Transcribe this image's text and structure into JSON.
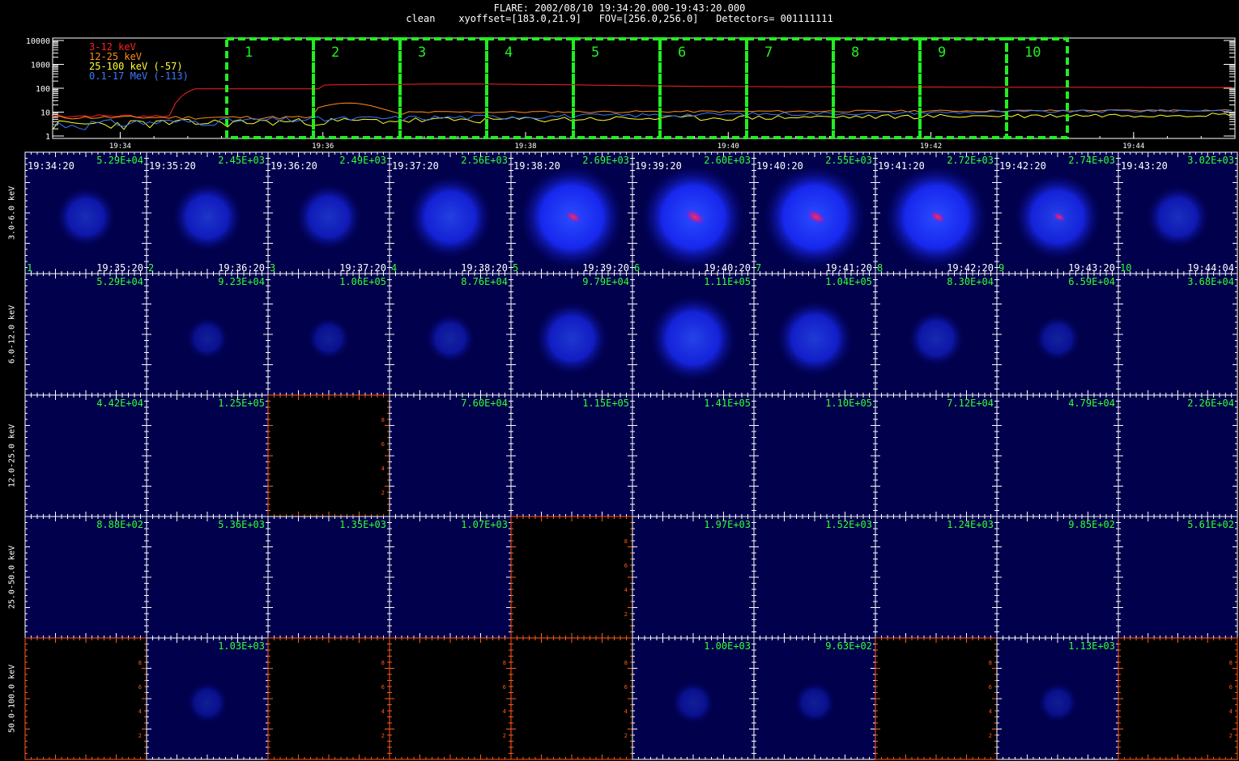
{
  "header": {
    "line1": "FLARE: 2002/08/10 19:34:20.000-19:43:20.000",
    "line2": "clean    xyoffset=[183.0,21.9]   FOV=[256.0,256.0]   Detectors= 001111111"
  },
  "lightcurve": {
    "y_ticks": [
      "10000",
      "1000",
      "100",
      "10",
      "1"
    ],
    "x_ticks": [
      "19:34",
      "19:36",
      "19:38",
      "19:40",
      "19:42",
      "19:44",
      "19:4"
    ],
    "legend": [
      {
        "label": "3-12 keV",
        "color": "#ff2020"
      },
      {
        "label": "12-25 keV",
        "color": "#ff8c1a"
      },
      {
        "label": "25-100 keV (-57)",
        "color": "#ffff33"
      },
      {
        "label": "0.1-17 MeV (-113)",
        "color": "#3a7bff"
      }
    ],
    "interval_labels": [
      "1",
      "2",
      "3",
      "4",
      "5",
      "6",
      "7",
      "8",
      "9",
      "10"
    ],
    "interval_color": "#22ee22"
  },
  "grid": {
    "energy_bands": [
      "3.0-6.0 keV",
      "6.0-12.0 keV",
      "12.0-25.0 keV",
      "25.0-50.0 keV",
      "50.0-100.0 keV"
    ],
    "start_times": [
      "19:34:20",
      "19:35:20",
      "19:36:20",
      "19:37:20",
      "19:38:20",
      "19:39:20",
      "19:40:20",
      "19:41:20",
      "19:42:20",
      "19:43:20"
    ],
    "end_times": [
      "19:35:20",
      "19:36:20",
      "19:37:20",
      "19:38:20",
      "19:39:20",
      "19:40:20",
      "19:41:20",
      "19:42:20",
      "19:43:20",
      "19:44:04"
    ],
    "cell_numbers": [
      "1",
      "2",
      "3",
      "4",
      "5",
      "6",
      "7",
      "8",
      "9",
      "10"
    ],
    "axis_ticks": [
      "2",
      "4",
      "6",
      "8"
    ],
    "rows": [
      {
        "values": [
          "5.29E+04",
          "2.45E+03",
          "2.49E+03",
          "2.56E+03",
          "2.69E+03",
          "2.60E+03",
          "2.55E+03",
          "2.72E+03",
          "2.74E+03",
          "3.02E+03"
        ],
        "empty": [
          false,
          false,
          false,
          false,
          false,
          false,
          false,
          false,
          false,
          false
        ],
        "source": [
          0.35,
          0.5,
          0.45,
          0.7,
          1.0,
          1.0,
          1.0,
          1.0,
          0.75,
          0.4
        ],
        "core": [
          0,
          0,
          0,
          0,
          0.35,
          0.55,
          0.5,
          0.35,
          0.2,
          0
        ]
      },
      {
        "values": [
          "5.29E+04",
          "9.23E+04",
          "1.06E+05",
          "8.76E+04",
          "9.79E+04",
          "1.11E+05",
          "1.04E+05",
          "8.30E+04",
          "6.59E+04",
          "3.68E+04"
        ],
        "empty": [
          false,
          false,
          false,
          false,
          false,
          false,
          false,
          false,
          false,
          false
        ],
        "source": [
          0,
          0.1,
          0.1,
          0.2,
          0.55,
          0.75,
          0.6,
          0.3,
          0.15,
          0
        ],
        "core": [
          0,
          0,
          0,
          0,
          0,
          0,
          0,
          0,
          0,
          0
        ]
      },
      {
        "values": [
          "4.42E+04",
          "1.25E+05",
          "",
          "7.60E+04",
          "1.15E+05",
          "1.41E+05",
          "1.10E+05",
          "7.12E+04",
          "4.79E+04",
          "2.26E+04"
        ],
        "empty": [
          false,
          false,
          true,
          false,
          false,
          false,
          false,
          false,
          false,
          false
        ],
        "source": [
          0,
          0,
          0,
          0,
          0,
          0,
          0,
          0,
          0,
          0
        ],
        "core": [
          0,
          0,
          0,
          0,
          0,
          0,
          0,
          0,
          0,
          0
        ]
      },
      {
        "values": [
          "8.88E+02",
          "5.36E+03",
          "1.35E+03",
          "1.07E+03",
          "",
          "1.97E+03",
          "1.52E+03",
          "1.24E+03",
          "9.85E+02",
          "5.61E+02"
        ],
        "empty": [
          false,
          false,
          false,
          false,
          true,
          false,
          false,
          false,
          false,
          false
        ],
        "source": [
          0,
          0,
          0,
          0,
          0,
          0,
          0,
          0,
          0,
          0
        ],
        "core": [
          0,
          0,
          0,
          0,
          0,
          0,
          0,
          0,
          0,
          0
        ]
      },
      {
        "values": [
          "",
          "1.03E+03",
          "",
          "",
          "",
          "1.00E+03",
          "9.63E+02",
          "",
          "1.13E+03",
          ""
        ],
        "empty": [
          true,
          false,
          true,
          true,
          true,
          false,
          false,
          true,
          false,
          true
        ],
        "source": [
          0,
          0.08,
          0,
          0,
          0,
          0.1,
          0.08,
          0,
          0.06,
          0
        ],
        "core": [
          0,
          0,
          0,
          0,
          0,
          0,
          0,
          0,
          0,
          0
        ]
      }
    ]
  }
}
